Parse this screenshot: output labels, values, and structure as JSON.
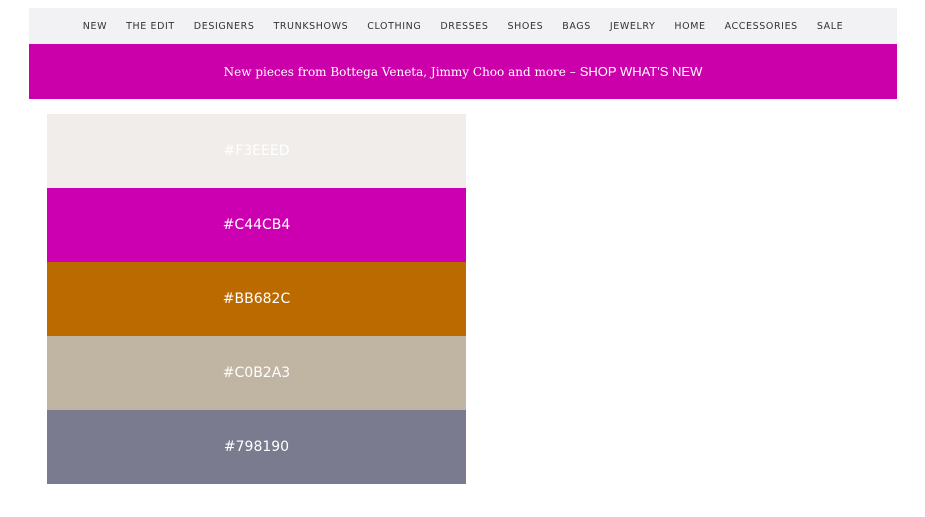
{
  "nav": {
    "items": [
      "NEW",
      "THE EDIT",
      "DESIGNERS",
      "TRUNKSHOWS",
      "CLOTHING",
      "DRESSES",
      "SHOES",
      "BAGS",
      "JEWELRY",
      "HOME",
      "ACCESSORIES",
      "SALE"
    ]
  },
  "banner": {
    "message": "New pieces from Bottega Veneta, Jimmy Choo and more –",
    "cta": "SHOP WHAT'S NEW",
    "color": "#cc00aa"
  },
  "swatches": [
    {
      "label": "#F3EEED",
      "color": "#f1edeb"
    },
    {
      "label": "#C44CB4",
      "color": "#cc00b1"
    },
    {
      "label": "#BB682C",
      "color": "#bb6a00"
    },
    {
      "label": "#C0B2A3",
      "color": "#c0b5a3"
    },
    {
      "label": "#798190",
      "color": "#7a7b8f"
    }
  ]
}
